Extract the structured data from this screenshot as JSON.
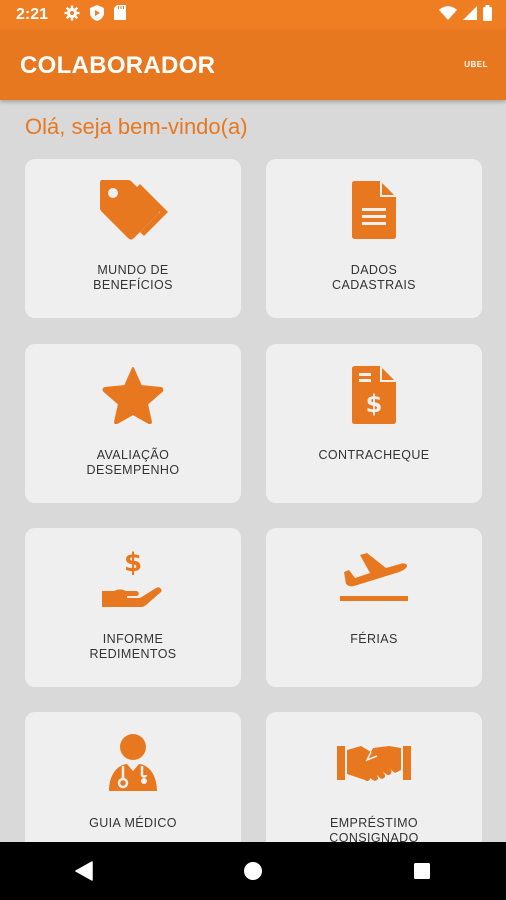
{
  "status_bar": {
    "time": "2:21",
    "left_icons": [
      "gear-icon",
      "shield-play-icon",
      "sd-card-icon"
    ],
    "right_icons": [
      "wifi-icon",
      "signal-icon",
      "battery-icon"
    ]
  },
  "app_bar": {
    "title": "COLABORADOR",
    "user": "UBEL"
  },
  "greeting": "Olá, seja bem-vindo(a)",
  "menu": [
    {
      "line1": "MUNDO DE",
      "line2": "BENEFÍCIOS",
      "icon": "tags-icon"
    },
    {
      "line1": "DADOS",
      "line2": "CADASTRAIS",
      "icon": "document-icon"
    },
    {
      "line1": "AVALIAÇÃO",
      "line2": "DESEMPENHO",
      "icon": "star-icon"
    },
    {
      "line1": "CONTRACHEQUE",
      "line2": "",
      "icon": "invoice-dollar-icon"
    },
    {
      "line1": "INFORME",
      "line2": "REDIMENTOS",
      "icon": "hand-dollar-icon"
    },
    {
      "line1": "FÉRIAS",
      "line2": "",
      "icon": "airplane-icon"
    },
    {
      "line1": "GUIA MÉDICO",
      "line2": "",
      "icon": "doctor-icon"
    },
    {
      "line1": "EMPRÉSTIMO",
      "line2": "CONSIGNADO",
      "icon": "handshake-icon"
    }
  ],
  "nav": [
    "back-icon",
    "home-icon",
    "recents-icon"
  ],
  "colors": {
    "accent": "#e8781f",
    "card": "#efefef",
    "background": "#d9d9d9"
  }
}
